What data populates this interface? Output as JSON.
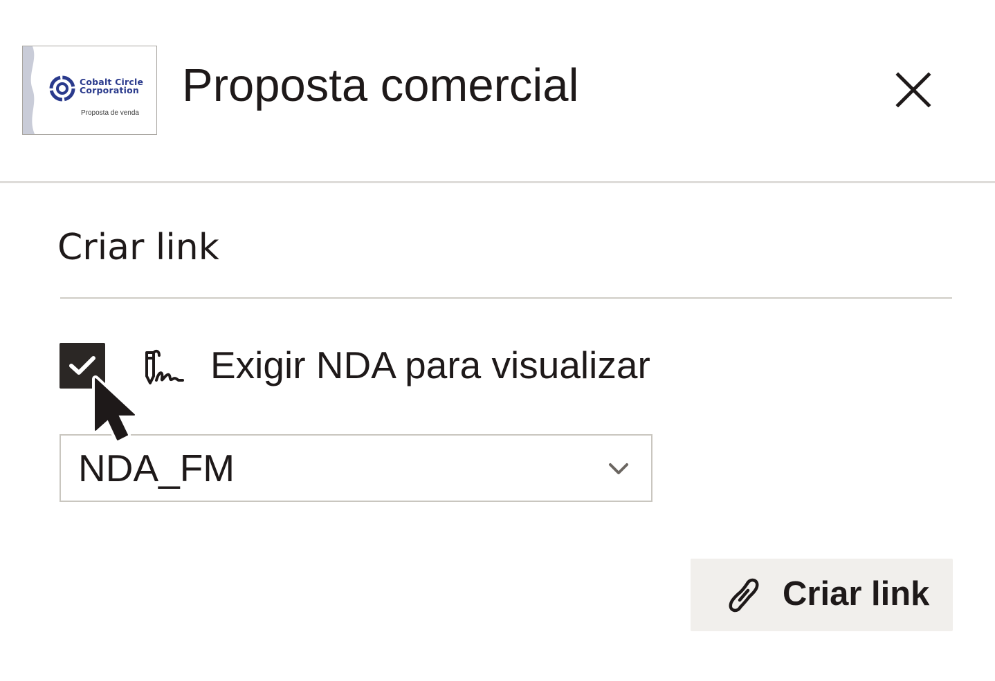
{
  "header": {
    "thumbnail": {
      "logo_text": "Cobalt Circle\nCorporation",
      "caption": "Proposta de venda",
      "brand_color": "#2a3a8c"
    },
    "title": "Proposta comercial",
    "close_icon": "close-icon"
  },
  "section": {
    "title": "Criar link"
  },
  "nda": {
    "checked": true,
    "icon": "signature-icon",
    "label": "Exigir NDA para visualizar"
  },
  "nda_select": {
    "selected": "NDA_FM",
    "icon": "chevron-down-icon"
  },
  "create_button": {
    "label": "Criar link",
    "icon": "link-icon",
    "background": "#f1efec"
  },
  "colors": {
    "text": "#1e1919",
    "checkbox": "#2b2725",
    "divider": "#cfccc5"
  }
}
